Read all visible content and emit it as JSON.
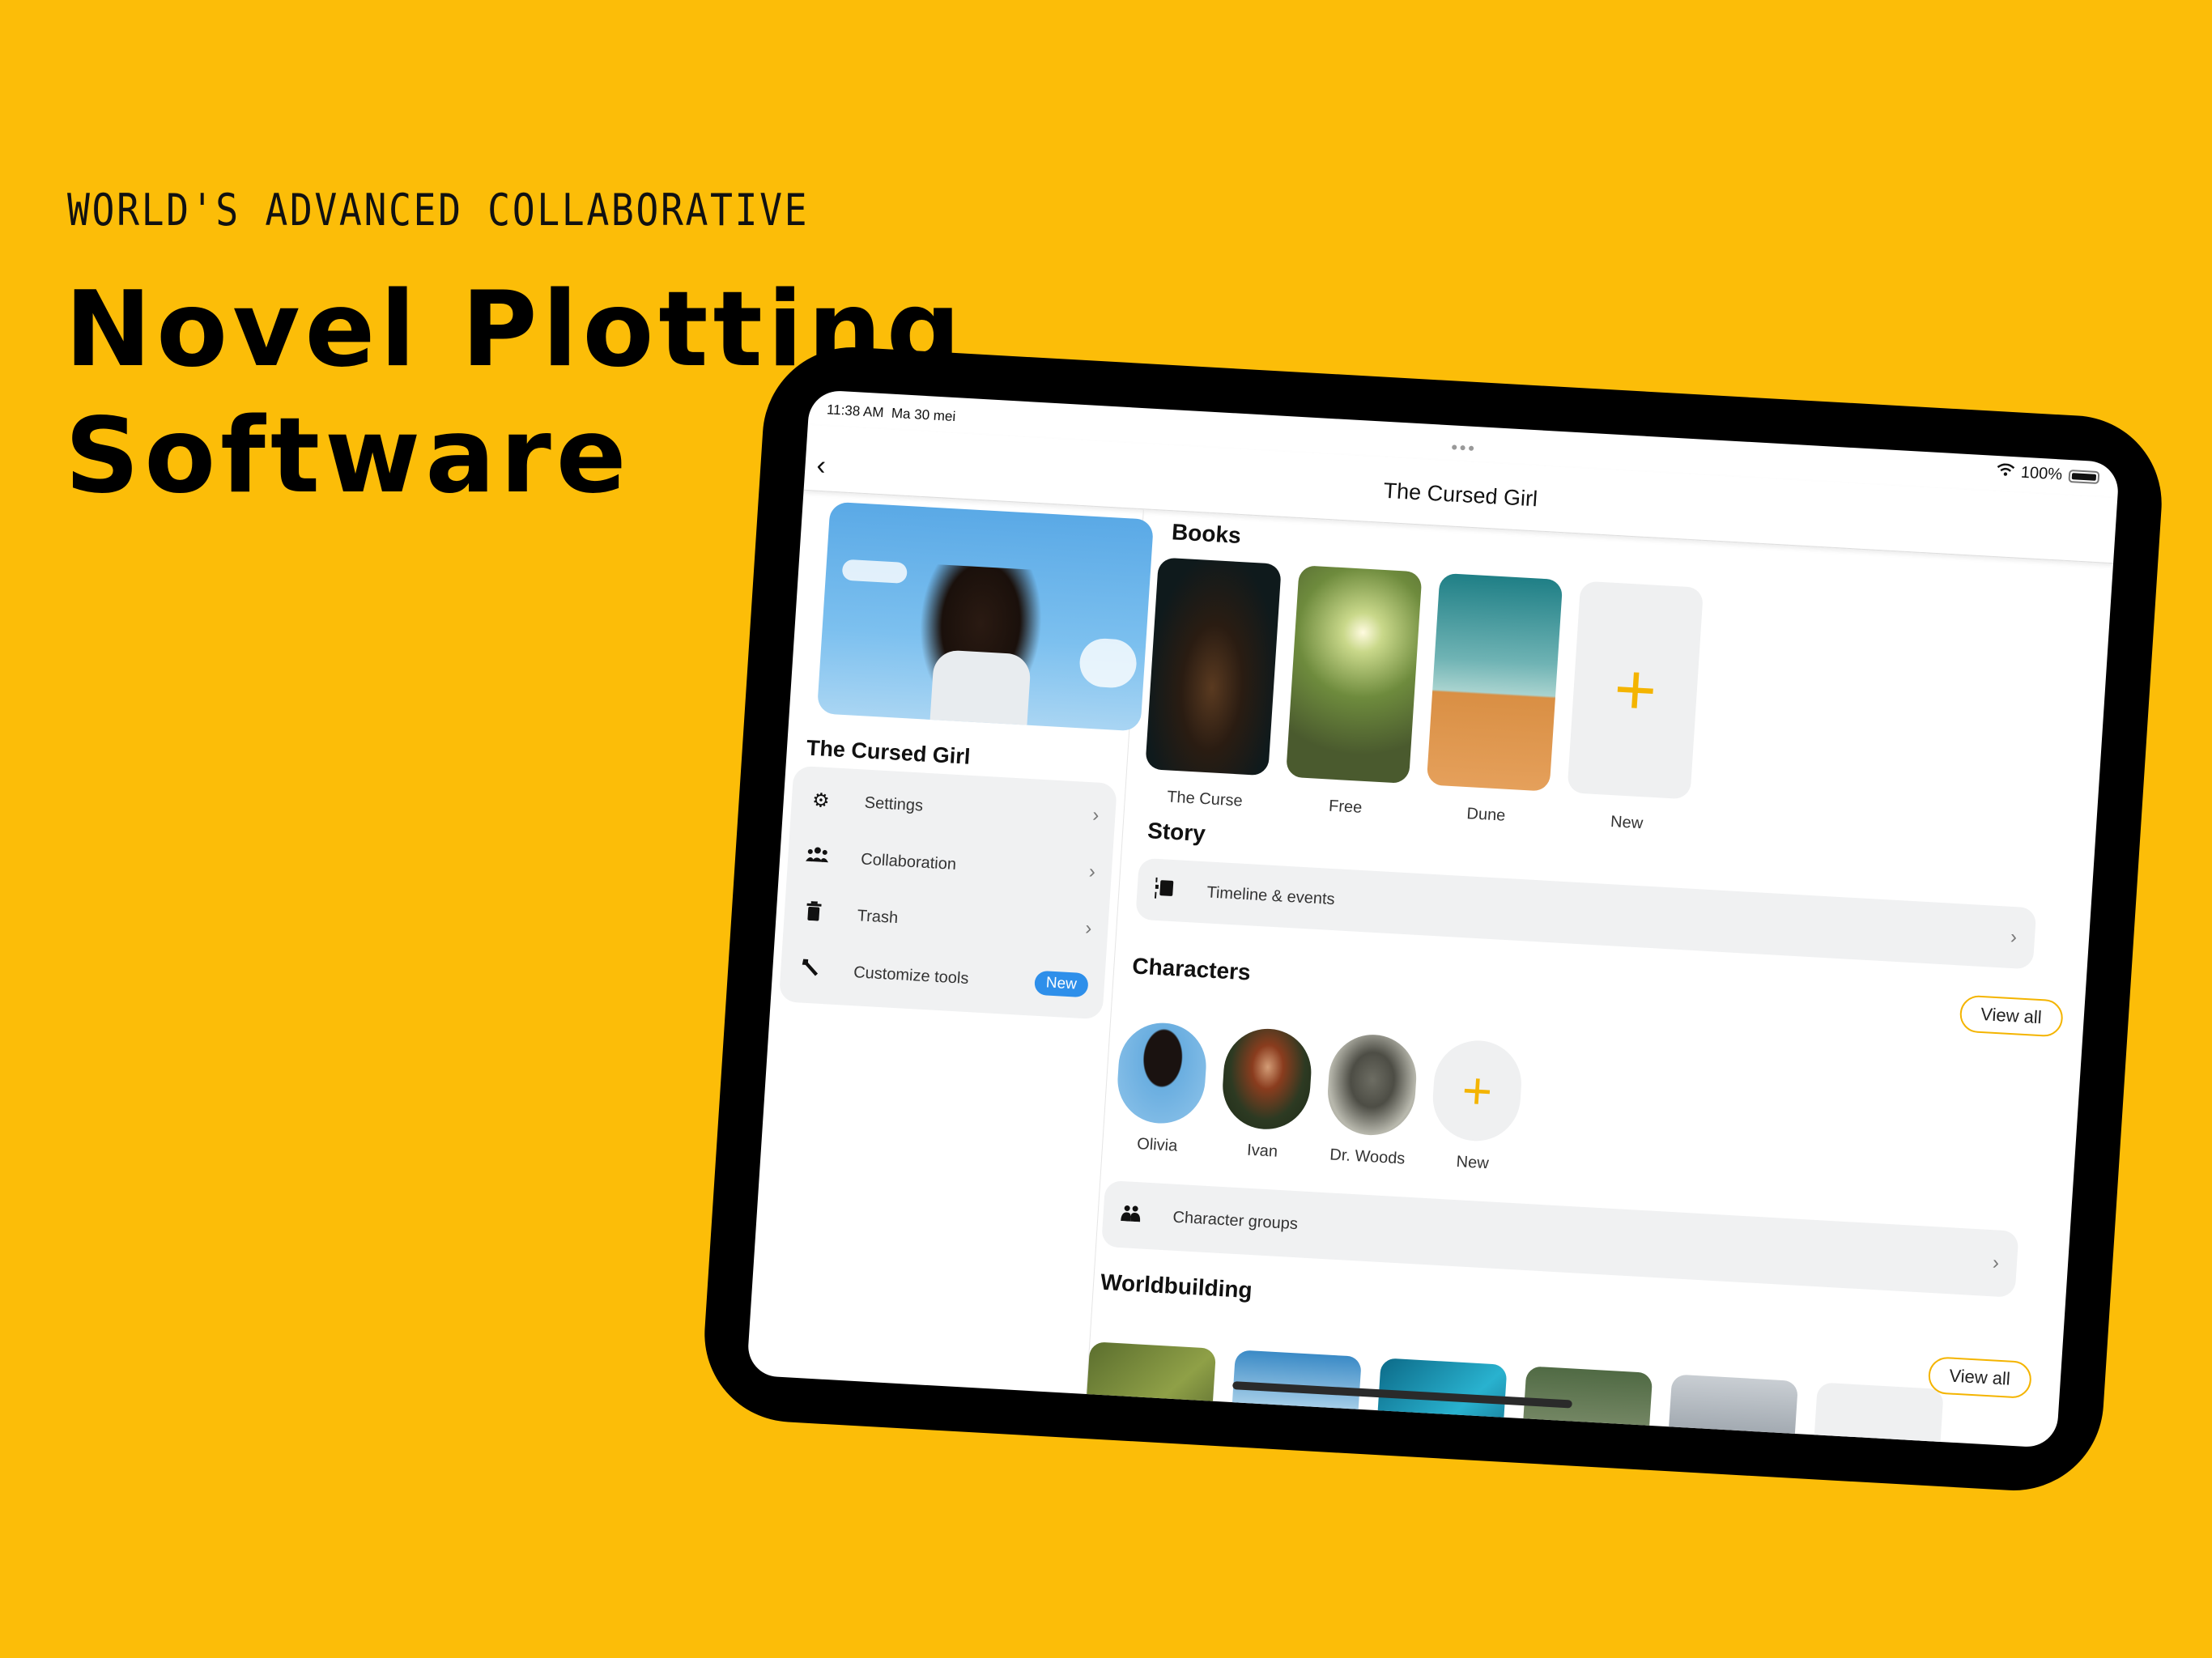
{
  "marketing": {
    "eyebrow": "WORLD'S ADVANCED COLLABORATIVE",
    "headline_line1": "Novel Plotting",
    "headline_line2": "Software",
    "background_color": "#FCBD08"
  },
  "status_bar": {
    "time": "11:38 AM",
    "date": "Ma 30 mei",
    "battery_text": "100%",
    "battery_level": 1.0,
    "wifi_icon": "wifi-icon",
    "more_icon": "ellipsis-icon"
  },
  "nav": {
    "back_icon": "chevron-left-icon",
    "title": "The Cursed Girl"
  },
  "sidebar": {
    "project_title": "The Cursed Girl",
    "items": [
      {
        "icon": "gear-icon",
        "glyph": "⚙",
        "label": "Settings",
        "trailing": "›"
      },
      {
        "icon": "people-icon",
        "glyph": "👥",
        "label": "Collaboration",
        "trailing": "›"
      },
      {
        "icon": "trash-icon",
        "glyph": "🗑",
        "label": "Trash",
        "trailing": "›"
      },
      {
        "icon": "wrench-icon",
        "glyph": "🔧",
        "label": "Customize tools",
        "badge": "New"
      }
    ]
  },
  "books": {
    "title": "Books",
    "items": [
      {
        "label": "The Curse"
      },
      {
        "label": "Free"
      },
      {
        "label": "Dune"
      },
      {
        "label": "New",
        "glyph": "+"
      }
    ]
  },
  "story": {
    "title": "Story",
    "row_label": "Timeline & events",
    "row_icon": "timeline-icon",
    "trailing": "›"
  },
  "characters": {
    "title": "Characters",
    "view_all": "View all",
    "items": [
      {
        "label": "Olivia"
      },
      {
        "label": "Ivan"
      },
      {
        "label": "Dr. Woods"
      },
      {
        "label": "New",
        "glyph": "+"
      }
    ],
    "groups_label": "Character groups",
    "groups_icon": "group-icon",
    "trailing": "›"
  },
  "worldbuilding": {
    "title": "Worldbuilding",
    "view_all": "View all",
    "new_glyph": "+"
  },
  "colors": {
    "accent": "#F4B400",
    "badge": "#2E8FEA",
    "card": "#F0F1F2"
  }
}
